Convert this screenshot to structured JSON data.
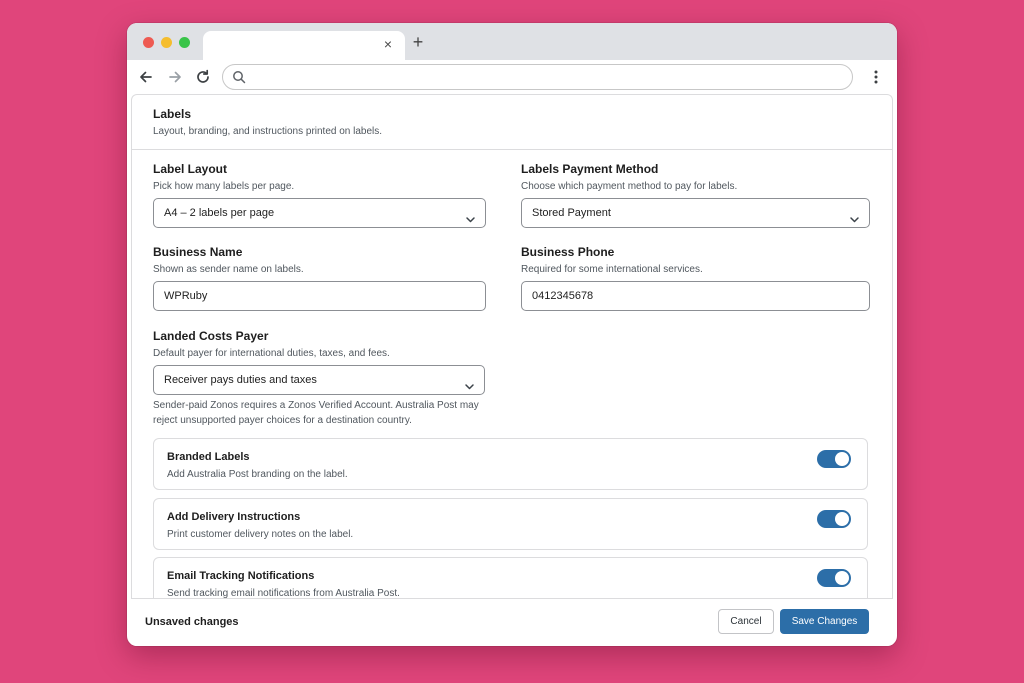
{
  "browser": {
    "tab_close": "×",
    "new_tab": "+",
    "address": ""
  },
  "section": {
    "title": "Labels",
    "description": "Layout, branding, and instructions printed on labels."
  },
  "fields": {
    "label_layout": {
      "label": "Label Layout",
      "help": "Pick how many labels per page.",
      "value": "A4 – 2 labels per page"
    },
    "payment_method": {
      "label": "Labels Payment Method",
      "help": "Choose which payment method to pay for labels.",
      "value": "Stored Payment"
    },
    "business_name": {
      "label": "Business Name",
      "help": "Shown as sender name on labels.",
      "value": "WPRuby"
    },
    "business_phone": {
      "label": "Business Phone",
      "help": "Required for some international services.",
      "value": "0412345678"
    },
    "landed_costs": {
      "label": "Landed Costs Payer",
      "help": "Default payer for international duties, taxes, and fees.",
      "value": "Receiver pays duties and taxes",
      "note": "Sender-paid Zonos requires a Zonos Verified Account. Australia Post may reject unsupported payer choices for a destination country."
    }
  },
  "toggles": [
    {
      "title": "Branded Labels",
      "description": "Add Australia Post branding on the label.",
      "on": true
    },
    {
      "title": "Add Delivery Instructions",
      "description": "Print customer delivery notes on the label.",
      "on": true
    },
    {
      "title": "Email Tracking Notifications",
      "description": "Send tracking email notifications from Australia Post.",
      "on": true
    }
  ],
  "footer": {
    "status": "Unsaved changes",
    "cancel_label": "Cancel",
    "save_label": "Save Changes"
  },
  "colors": {
    "background": "#e0457b",
    "accent": "#2c6ea8"
  }
}
